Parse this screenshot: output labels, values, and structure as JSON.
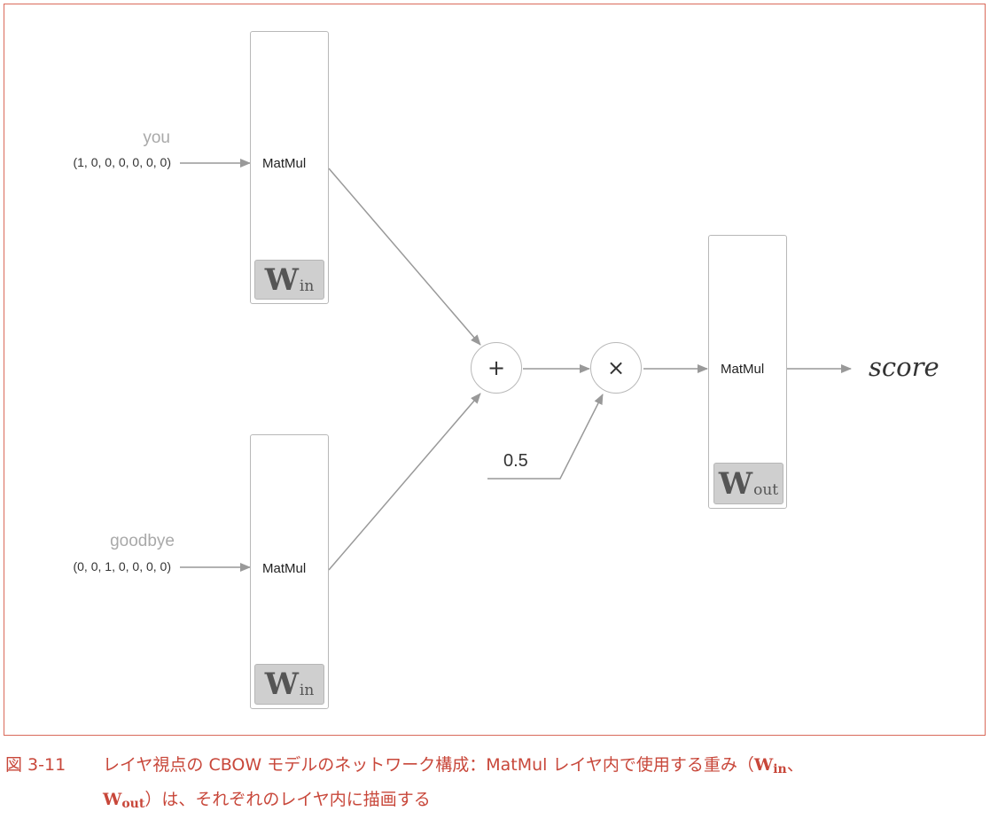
{
  "diagram": {
    "input_top": {
      "word": "you",
      "vector": "(1, 0, 0, 0, 0, 0, 0)"
    },
    "input_bottom": {
      "word": "goodbye",
      "vector": "(0, 0, 1, 0, 0, 0, 0)"
    },
    "matmul_label": "MatMul",
    "w_letter": "W",
    "w_in_sub": "in",
    "w_out_sub": "out",
    "plus_symbol": "+",
    "times_symbol": "×",
    "half_value": "0.5",
    "output_label": "score"
  },
  "caption": {
    "number": "図 3-11",
    "text_before": "レイヤ視点の CBOW モデルのネットワーク構成：MatMul レイヤ内で使用する重み（",
    "w1": "W",
    "w1_sub": "in",
    "sep": "、",
    "w2": "W",
    "w2_sub": "out",
    "text_after": "）は、それぞれのレイヤ内に描画する"
  },
  "colors": {
    "frame": "#d96a5a",
    "caption": "#c8473a",
    "arrow": "#999999",
    "weight_tag": "#cfcfcf"
  }
}
